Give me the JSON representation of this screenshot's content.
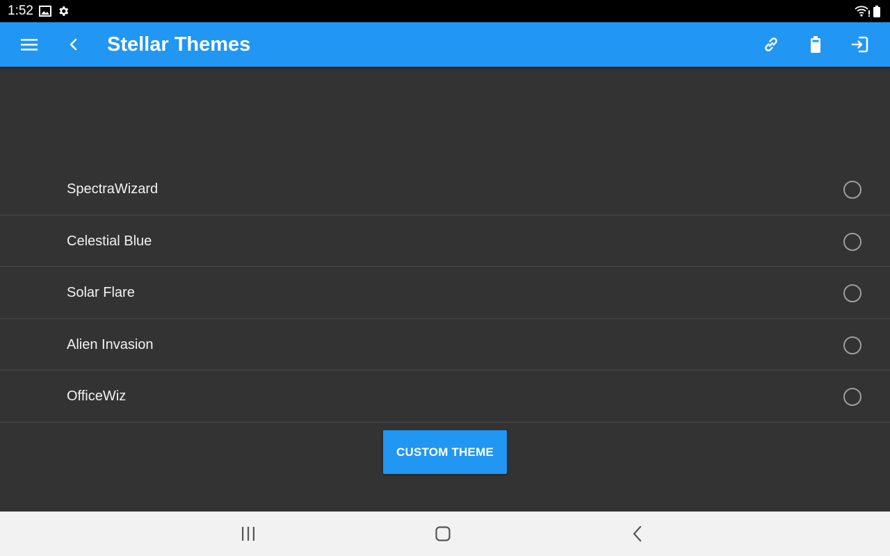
{
  "status_bar": {
    "time": "1:52",
    "icons": [
      "image-icon",
      "gear-icon",
      "wifi-icon",
      "battery-icon"
    ]
  },
  "app_bar": {
    "title": "Stellar Themes",
    "background_color": "#2196F3",
    "icons": [
      "menu-icon",
      "back-arrow-icon",
      "link-icon",
      "battery-icon",
      "exit-icon"
    ]
  },
  "themes": {
    "items": [
      {
        "label": "SpectraWizard",
        "selected": false
      },
      {
        "label": "Celestial Blue",
        "selected": false
      },
      {
        "label": "Solar Flare",
        "selected": false
      },
      {
        "label": "Alien Invasion",
        "selected": false
      },
      {
        "label": "OfficeWiz",
        "selected": false
      }
    ]
  },
  "custom_button": {
    "label": "CUSTOM THEME",
    "color": "#2196F3"
  },
  "nav_bar": {
    "icons": [
      "recent-apps-icon",
      "home-icon",
      "back-icon"
    ]
  },
  "colors": {
    "background": "#333333",
    "divider": "#4a4a4a",
    "radio_border": "#9e9e9e"
  }
}
